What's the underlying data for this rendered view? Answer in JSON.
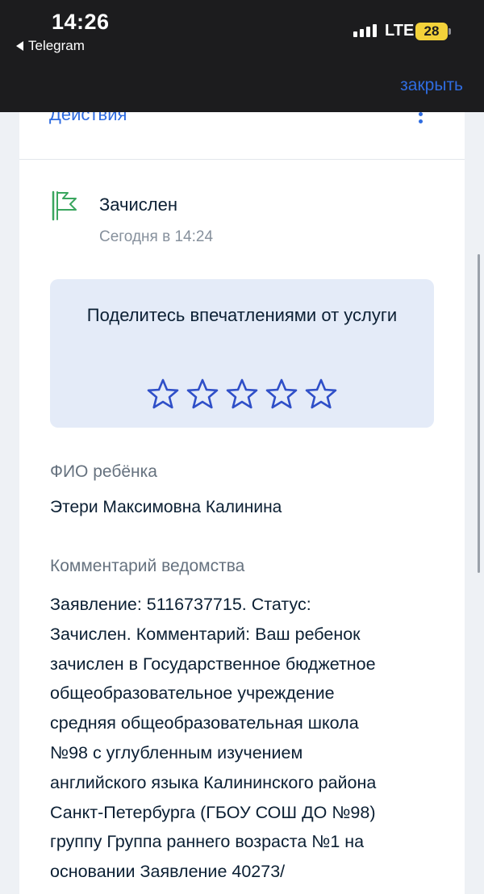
{
  "status_bar": {
    "time": "14:26",
    "back_app": "Telegram",
    "network": "LTE",
    "battery": "28"
  },
  "header": {
    "close_label": "закрыть"
  },
  "actions": {
    "label": "Действия",
    "menu_icon": "kebab-icon"
  },
  "status": {
    "title": "Зачислен",
    "time": "Сегодня в 14:24",
    "icon": "flag-icon",
    "icon_color": "#3aa65f"
  },
  "feedback": {
    "text": "Поделитесь впечатлениями от услуги",
    "rating": 0,
    "max_rating": 5,
    "star_color": "#2f4fc8"
  },
  "child": {
    "label": "ФИО ребёнка",
    "value": "Этери Максимовна Калинина"
  },
  "comment": {
    "label": "Комментарий ведомства",
    "text": "Заявление: 5116737715. Статус:\nЗачислен. Комментарий: Ваш ребенок\nзачислен в Государственное бюджетное\nобщеобразовательное учреждение\nсредняя общеобразовательная школа\n№98 с углубленным изучением\nанглийского языка Калининского района\nСанкт-Петербурга (ГБОУ СОШ ДО №98)\nгруппу Группа раннего возраста №1 на\nосновании Заявление 40273/"
  },
  "colors": {
    "accent": "#2f6ce0",
    "text": "#0b1f33",
    "muted": "#66727f",
    "feedback_bg": "#e4ebf8"
  }
}
